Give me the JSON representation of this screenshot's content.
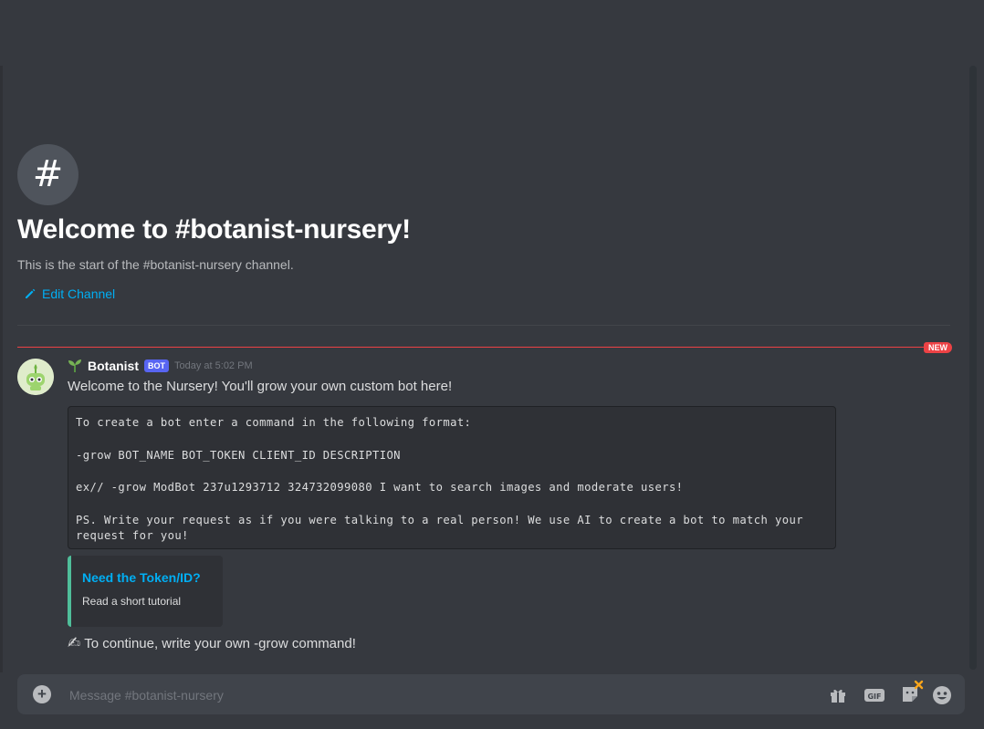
{
  "channel": {
    "icon": "#",
    "welcome_title": "Welcome to #botanist-nursery!",
    "welcome_sub": "This is the start of the #botanist-nursery channel.",
    "edit_label": "Edit Channel"
  },
  "new_badge": "NEW",
  "message": {
    "author": "Botanist",
    "bot_tag": "BOT",
    "timestamp": "Today at 5:02 PM",
    "text": "Welcome to the Nursery! You'll grow your own custom bot here!",
    "code_lines": [
      "To create a bot enter a command in the following format:",
      "-grow BOT_NAME BOT_TOKEN CLIENT_ID DESCRIPTION",
      "ex// -grow ModBot 237u1293712 324732099080 I want to search images and moderate users!",
      "PS. Write your request as if you were talking to a real person! We use AI to create a bot to match your request for you!"
    ],
    "embed_title": "Need the Token/ID?",
    "embed_desc": "Read a short tutorial",
    "continue_text": "To continue, write your own -grow command!"
  },
  "composer": {
    "placeholder": "Message #botanist-nursery"
  },
  "icons": {
    "add": "plus-circle-icon",
    "gift": "gift-icon",
    "gif": "gif-icon",
    "sticker": "sticker-icon",
    "emoji": "emoji-icon"
  },
  "colors": {
    "background": "#36393f",
    "accent_link": "#00aff4",
    "new_divider": "#ed4245",
    "bot_tag": "#5865f2",
    "embed_border": "#4fbe9a"
  }
}
